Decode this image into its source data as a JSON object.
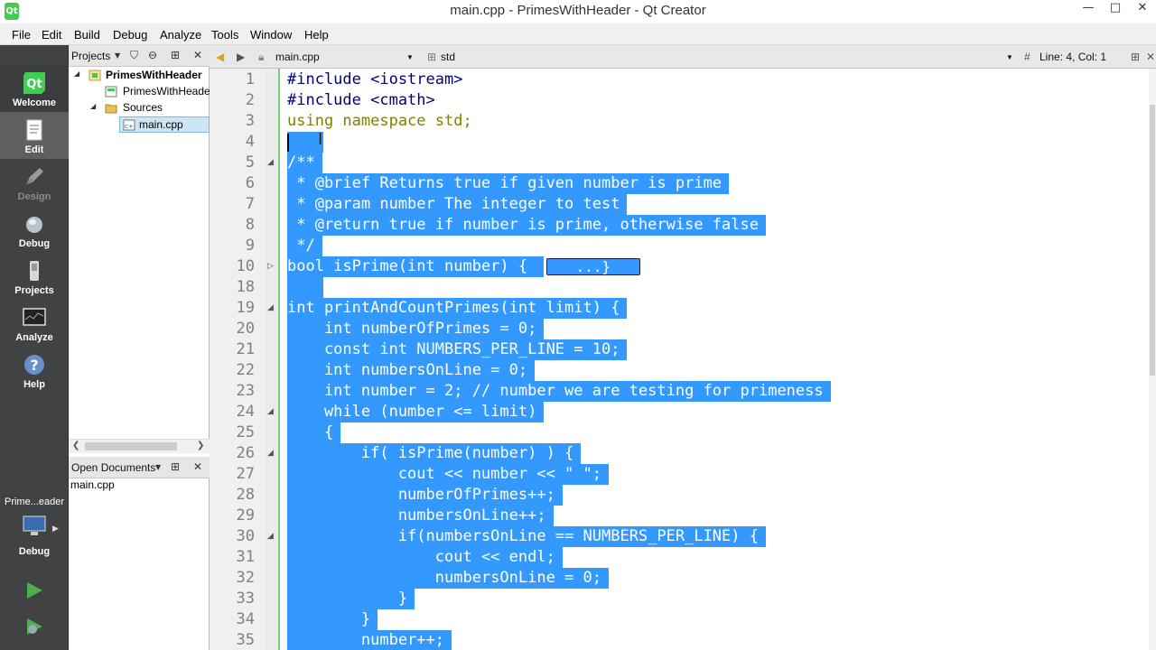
{
  "window": {
    "title": "main.cpp - PrimesWithHeader - Qt Creator",
    "minimize": "—",
    "maximize": "□",
    "close": "✕"
  },
  "menu": [
    "File",
    "Edit",
    "Build",
    "Debug",
    "Analyze",
    "Tools",
    "Window",
    "Help"
  ],
  "modes": [
    {
      "label": "Welcome",
      "icon": "qt-logo-icon"
    },
    {
      "label": "Edit",
      "icon": "document-icon"
    },
    {
      "label": "Design",
      "icon": "design-pen-icon"
    },
    {
      "label": "Debug",
      "icon": "bug-icon"
    },
    {
      "label": "Projects",
      "icon": "wrench-icon"
    },
    {
      "label": "Analyze",
      "icon": "monitor-icon"
    },
    {
      "label": "Help",
      "icon": "help-icon"
    }
  ],
  "kit": {
    "name": "Prime...eader",
    "mode": "Debug"
  },
  "projects_pane": {
    "title": "Projects",
    "tree": [
      {
        "label": "PrimesWithHeader",
        "level": 0,
        "expanded": true,
        "bold": true,
        "icon": "project-icon"
      },
      {
        "label": "PrimesWithHeader",
        "level": 1,
        "icon": "pro-file-icon"
      },
      {
        "label": "Sources",
        "level": 1,
        "expanded": true,
        "icon": "folder-icon"
      },
      {
        "label": "main.cpp",
        "level": 2,
        "icon": "cpp-file-icon",
        "selected": true
      }
    ]
  },
  "open_documents": {
    "title": "Open Documents",
    "items": [
      "main.cpp"
    ]
  },
  "editor_toolbar": {
    "file": "main.cpp",
    "symbol": "std",
    "position": "Line: 4, Col: 1"
  },
  "fold_placeholder": "...}",
  "code_lines": [
    {
      "n": "1",
      "text": "#include <iostream>",
      "style": "include",
      "sel": false
    },
    {
      "n": "2",
      "text": "#include <cmath>",
      "style": "include",
      "sel": false
    },
    {
      "n": "3",
      "text": "using namespace std;",
      "style": "keyword",
      "sel": false
    },
    {
      "n": "4",
      "text": "",
      "style": "",
      "sel": true,
      "caret": true
    },
    {
      "n": "5",
      "text": "/**",
      "style": "",
      "sel": true,
      "fold": "open"
    },
    {
      "n": "6",
      "text": " * @brief Returns true if given number is prime",
      "style": "",
      "sel": true
    },
    {
      "n": "7",
      "text": " * @param number The integer to test",
      "style": "",
      "sel": true
    },
    {
      "n": "8",
      "text": " * @return true if number is prime, otherwise false",
      "style": "",
      "sel": true
    },
    {
      "n": "9",
      "text": " */",
      "style": "",
      "sel": true
    },
    {
      "n": "10",
      "text": "bool isPrime(int number) { ",
      "style": "",
      "sel": true,
      "fold": "closed",
      "placeholder": true
    },
    {
      "n": "18",
      "text": "",
      "style": "",
      "sel": true
    },
    {
      "n": "19",
      "text": "int printAndCountPrimes(int limit) {",
      "style": "",
      "sel": true,
      "fold": "open"
    },
    {
      "n": "20",
      "text": "    int numberOfPrimes = 0;",
      "style": "",
      "sel": true
    },
    {
      "n": "21",
      "text": "    const int NUMBERS_PER_LINE = 10;",
      "style": "",
      "sel": true
    },
    {
      "n": "22",
      "text": "    int numbersOnLine = 0;",
      "style": "",
      "sel": true
    },
    {
      "n": "23",
      "text": "    int number = 2; // number we are testing for primeness",
      "style": "",
      "sel": true
    },
    {
      "n": "24",
      "text": "    while (number <= limit)",
      "style": "",
      "sel": true,
      "fold": "open"
    },
    {
      "n": "25",
      "text": "    {",
      "style": "",
      "sel": true
    },
    {
      "n": "26",
      "text": "        if( isPrime(number) ) {",
      "style": "",
      "sel": true,
      "fold": "open"
    },
    {
      "n": "27",
      "text": "            cout << number << \" \";",
      "style": "",
      "sel": true
    },
    {
      "n": "28",
      "text": "            numberOfPrimes++;",
      "style": "",
      "sel": true
    },
    {
      "n": "29",
      "text": "            numbersOnLine++;",
      "style": "",
      "sel": true
    },
    {
      "n": "30",
      "text": "            if(numbersOnLine == NUMBERS_PER_LINE) {",
      "style": "",
      "sel": true,
      "fold": "open"
    },
    {
      "n": "31",
      "text": "                cout << endl;",
      "style": "",
      "sel": true
    },
    {
      "n": "32",
      "text": "                numbersOnLine = 0;",
      "style": "",
      "sel": true
    },
    {
      "n": "33",
      "text": "            }",
      "style": "",
      "sel": true
    },
    {
      "n": "34",
      "text": "        }",
      "style": "",
      "sel": true
    },
    {
      "n": "35",
      "text": "        number++;",
      "style": "",
      "sel": true
    }
  ],
  "colors": {
    "selection": "#3399ff",
    "modebar": "#404244",
    "gutter_marker": "#7ccc7c"
  }
}
